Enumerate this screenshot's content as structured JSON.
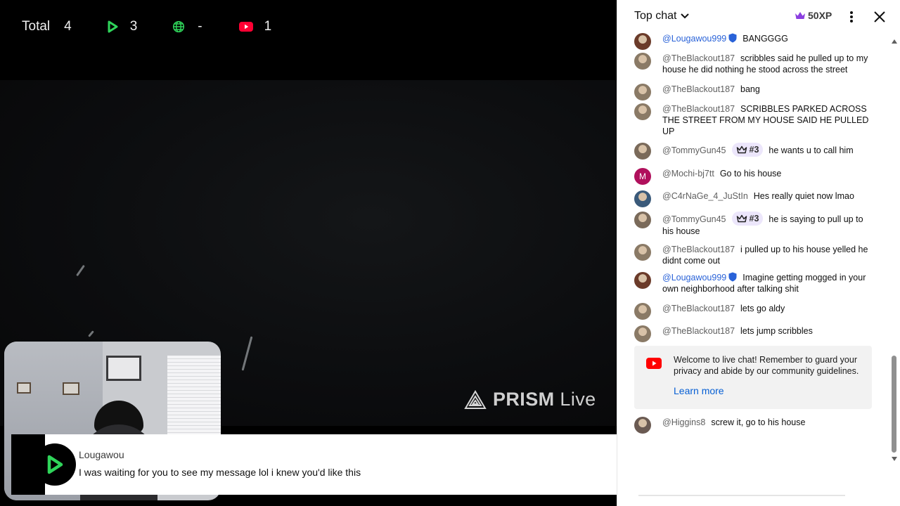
{
  "stats": {
    "total_label": "Total",
    "total_value": "4",
    "play_value": "3",
    "globe_value": "-",
    "youtube_value": "1",
    "icons": [
      "play-icon",
      "globe-icon",
      "youtube-icon"
    ]
  },
  "watermark": {
    "brand": "PRISM",
    "suffix": "Live"
  },
  "alert": {
    "name": "Lougawou",
    "message": "I was waiting for you to see my message lol i knew you'd like this",
    "accent": "#2fd45a"
  },
  "chat": {
    "mode_label": "Top chat",
    "xp_label": "50XP",
    "messages": [
      {
        "author": "@Lougawou999",
        "text": "BANGGGG",
        "owner": true
      },
      {
        "author": "@TheBlackout187",
        "text": "scribbles said he pulled up to my house he did nothing he stood across the street"
      },
      {
        "author": "@TheBlackout187",
        "text": "bang"
      },
      {
        "author": "@TheBlackout187",
        "text": "SCRIBBLES PARKED ACROSS THE STREET FROM MY HOUSE SAID HE PULLED UP"
      },
      {
        "author": "@TommyGun45",
        "badge": "#3",
        "text": "he wants u to call him"
      },
      {
        "author": "@Mochi-bj7tt",
        "avatar_letter": "M",
        "text": "Go to his house"
      },
      {
        "author": "@C4rNaGe_4_JuStIn",
        "text": "Hes really quiet now lmao"
      },
      {
        "author": "@TommyGun45",
        "badge": "#3",
        "text": "he is saying to pull up to his house"
      },
      {
        "author": "@TheBlackout187",
        "text": "i pulled up to his house yelled he didnt come out"
      },
      {
        "author": "@Lougawou999",
        "text": "Imagine getting mogged in your own neighborhood after talking shit",
        "owner": true
      },
      {
        "author": "@TheBlackout187",
        "text": "lets go aldy"
      },
      {
        "author": "@TheBlackout187",
        "text": "lets jump scribbles"
      },
      {
        "author": "@Higgins8",
        "text": "screw it, go to his house"
      }
    ],
    "welcome_text": "Welcome to live chat! Remember to guard your privacy and abide by our community guidelines.",
    "learn_more": "Learn more"
  },
  "colors": {
    "owner_name": "#2962d8",
    "verified_shield": "#2962d8",
    "member_badge_bg": "#ece6fb",
    "youtube_red": "#ff0000",
    "link": "#065fd4"
  }
}
